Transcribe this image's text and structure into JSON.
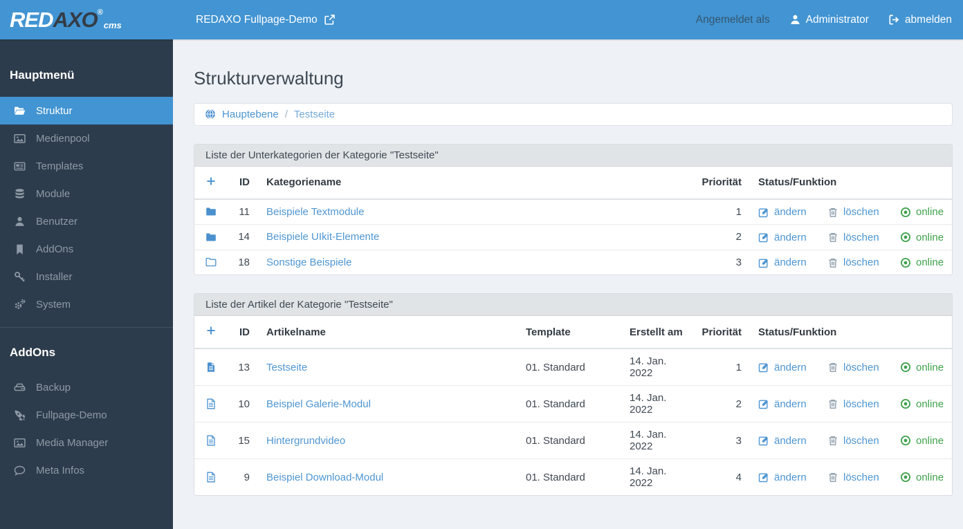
{
  "colors": {
    "header_blue": "#4294d2",
    "sidebar_dark": "#2d3c4c",
    "link_blue": "#4d95d1",
    "online_green": "#3fa14b",
    "content_bg": "#eef1f5"
  },
  "topbar": {
    "logo_red": "RED",
    "logo_axo": "AXO",
    "logo_reg": "®",
    "logo_cms": "cms",
    "site_link": "REDAXO Fullpage-Demo",
    "logged_in_label": "Angemeldet als",
    "user_name": "Administrator",
    "logout_label": "abmelden"
  },
  "sidebar": {
    "main_heading": "Hauptmenü",
    "main_items": [
      {
        "label": "Struktur",
        "icon": "folder-open"
      },
      {
        "label": "Medienpool",
        "icon": "image"
      },
      {
        "label": "Templates",
        "icon": "newspaper"
      },
      {
        "label": "Module",
        "icon": "database"
      },
      {
        "label": "Benutzer",
        "icon": "user"
      },
      {
        "label": "AddOns",
        "icon": "bookmark"
      },
      {
        "label": "Installer",
        "icon": "key"
      },
      {
        "label": "System",
        "icon": "cogs"
      }
    ],
    "addons_heading": "AddOns",
    "addon_items": [
      {
        "label": "Backup",
        "icon": "hdd"
      },
      {
        "label": "Fullpage-Demo",
        "icon": "rocket"
      },
      {
        "label": "Media Manager",
        "icon": "image"
      },
      {
        "label": "Meta Infos",
        "icon": "comment"
      }
    ]
  },
  "page": {
    "title": "Strukturverwaltung",
    "breadcrumb": {
      "root": "Hauptebene",
      "separator": "/",
      "current": "Testseite"
    }
  },
  "actions": {
    "edit": "ändern",
    "delete": "löschen",
    "online": "online"
  },
  "categories": {
    "caption": "Liste der Unterkategorien der Kategorie \"Testseite\"",
    "headers": {
      "id": "ID",
      "name": "Kategoriename",
      "priority": "Priorität",
      "status": "Status/Funktion"
    },
    "rows": [
      {
        "id": "11",
        "name": "Beispiele Textmodule",
        "priority": "1",
        "icon": "folder-solid"
      },
      {
        "id": "14",
        "name": "Beispiele UIkit-Elemente",
        "priority": "2",
        "icon": "folder-solid"
      },
      {
        "id": "18",
        "name": "Sonstige Beispiele",
        "priority": "3",
        "icon": "folder-outline"
      }
    ]
  },
  "articles": {
    "caption": "Liste der Artikel der Kategorie \"Testseite\"",
    "headers": {
      "id": "ID",
      "name": "Artikelname",
      "template": "Template",
      "created": "Erstellt am",
      "priority": "Priorität",
      "status": "Status/Funktion"
    },
    "rows": [
      {
        "id": "13",
        "name": "Testseite",
        "template": "01. Standard",
        "created": "14. Jan. 2022",
        "priority": "1",
        "icon": "file-solid"
      },
      {
        "id": "10",
        "name": "Beispiel Galerie-Modul",
        "template": "01. Standard",
        "created": "14. Jan. 2022",
        "priority": "2",
        "icon": "file-outline"
      },
      {
        "id": "15",
        "name": "Hintergrundvideo",
        "template": "01. Standard",
        "created": "14. Jan. 2022",
        "priority": "3",
        "icon": "file-outline"
      },
      {
        "id": "9",
        "name": "Beispiel Download-Modul",
        "template": "01. Standard",
        "created": "14. Jan. 2022",
        "priority": "4",
        "icon": "file-outline"
      }
    ]
  }
}
